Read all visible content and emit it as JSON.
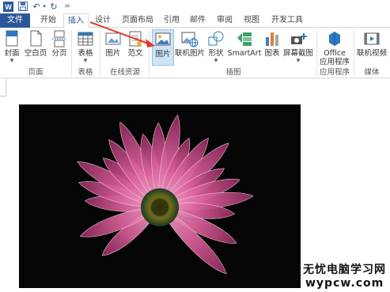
{
  "quick_access": {
    "undo_glyph": "↶",
    "redo_glyph": "↻",
    "more_glyph": "="
  },
  "tabs": [
    "文件",
    "开始",
    "插入",
    "设计",
    "页面布局",
    "引用",
    "邮件",
    "审阅",
    "视图",
    "开发工具"
  ],
  "ribbon": {
    "buttons": {
      "cover": "封面",
      "blank_page": "空白页",
      "page_break": "分页",
      "table": "表格",
      "online_picture_small": "图片",
      "template": "范文",
      "picture": "图片",
      "online_picture": "联机图片",
      "shapes": "形状",
      "smartart": "SmartArt",
      "chart": "图表",
      "screenshot": "屏幕截图",
      "office_apps": "Office",
      "office_apps_sub": "应用程序",
      "online_video": "联机视频"
    },
    "groups": {
      "pages": "页面",
      "tables": "表格",
      "online_resources": "在线资源",
      "illustrations": "插图",
      "apps": "应用程序",
      "media": "媒体"
    }
  },
  "watermark": {
    "line1": "无忧电脑学习网",
    "line2": "wypcw.com"
  },
  "colors": {
    "file_tab": "#2b579a",
    "selected_button": "#cde3f7",
    "arrow": "#e03a2f",
    "petal": "#d9609a"
  }
}
